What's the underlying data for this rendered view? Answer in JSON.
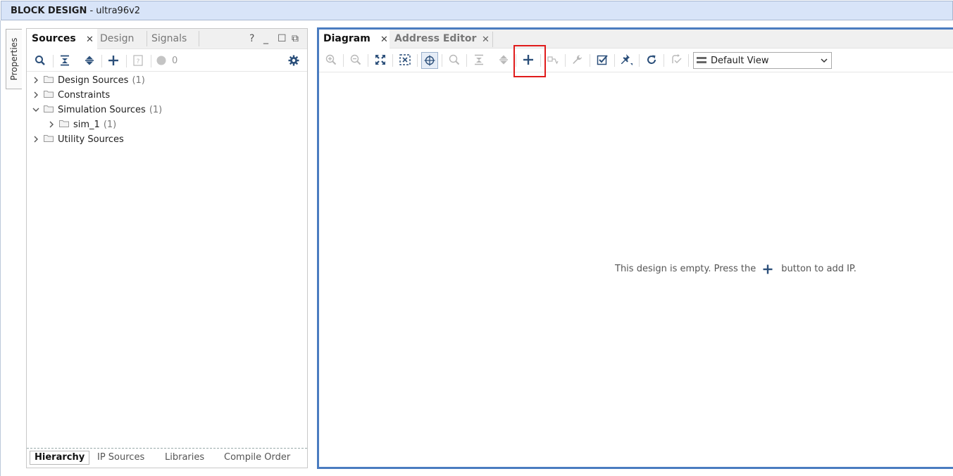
{
  "window": {
    "title_bold": "BLOCK DESIGN",
    "title_rest": " - ultra96v2"
  },
  "side_tab": {
    "label": "Properties"
  },
  "sources": {
    "tabs": [
      {
        "label": "Sources",
        "active": true
      },
      {
        "label": "Design",
        "active": false
      },
      {
        "label": "Signals",
        "active": false
      }
    ],
    "toolbar": {
      "status_count": "0"
    },
    "tree": [
      {
        "label": "Design Sources",
        "count": "(1)",
        "expanded": false
      },
      {
        "label": "Constraints",
        "count": "",
        "expanded": false
      },
      {
        "label": "Simulation Sources",
        "count": "(1)",
        "expanded": true
      },
      {
        "label": "sim_1",
        "count": "(1)",
        "expanded": false
      },
      {
        "label": "Utility Sources",
        "count": "",
        "expanded": false
      }
    ],
    "bottom_tabs": [
      {
        "label": "Hierarchy",
        "active": true
      },
      {
        "label": "IP Sources",
        "active": false
      },
      {
        "label": "Libraries",
        "active": false
      },
      {
        "label": "Compile Order",
        "active": false
      }
    ]
  },
  "diagram": {
    "tabs": [
      {
        "label": "Diagram",
        "active": true
      },
      {
        "label": "Address Editor",
        "active": false
      }
    ],
    "view_select": {
      "value": "Default View"
    },
    "empty_message": {
      "before": "This design is empty. Press the",
      "after": "button to add IP."
    }
  },
  "colors": {
    "accent_border": "#4a7cc0",
    "highlight": "#e01b1b",
    "icon": "#2b4f7a",
    "title_bg": "#d8e4f8"
  },
  "icons": [
    "search-icon",
    "collapse-all-icon",
    "expand-all-icon",
    "add-icon",
    "help-icon",
    "status-dot-icon",
    "gear-icon",
    "zoom-in-icon",
    "zoom-out-icon",
    "fit-icon",
    "fit-selection-icon",
    "select-area-icon",
    "search-icon",
    "collapse-icon",
    "expand-icon",
    "add-ip-icon",
    "route-icon",
    "wrench-icon",
    "validate-icon",
    "pin-icon",
    "refresh-icon",
    "regenerate-icon"
  ]
}
